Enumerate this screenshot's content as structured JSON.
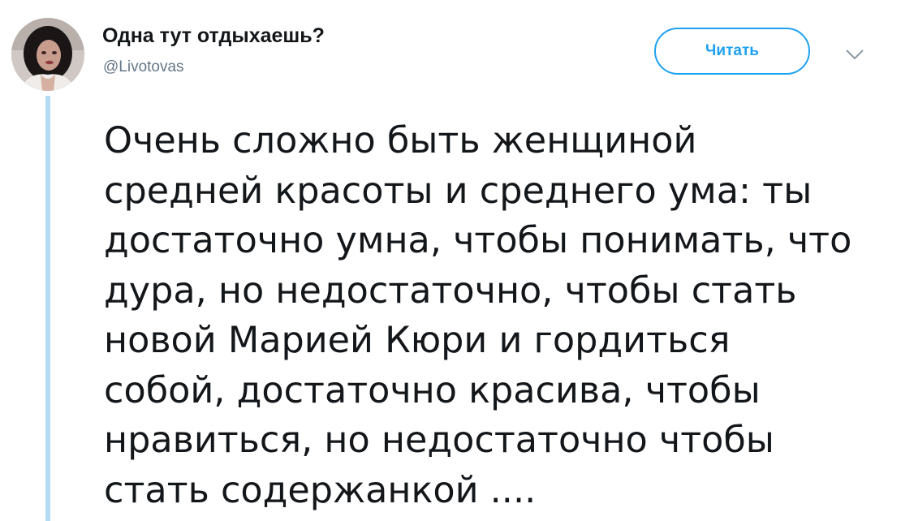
{
  "tweet": {
    "author_name": "Одна тут отдыхаешь?",
    "author_handle": "@Livotovas",
    "follow_label": "Читать",
    "text": "Очень сложно быть женщиной\nсредней красоты и среднего ума: ты\nдостаточно умна, чтобы понимать, что\nдура, но недостаточно, чтобы стать\nновой Марией Кюри и гордиться\nсобой, достаточно красива, чтобы\nнравиться, но недостаточно чтобы\nстать содержанкой ...."
  },
  "icons": {
    "avatar": "user-avatar-photo",
    "menu": "chevron-down-icon"
  },
  "colors": {
    "accent": "#1da1f2",
    "text": "#14171a",
    "handle": "#657786",
    "thread_line": "#b3dbf4"
  }
}
